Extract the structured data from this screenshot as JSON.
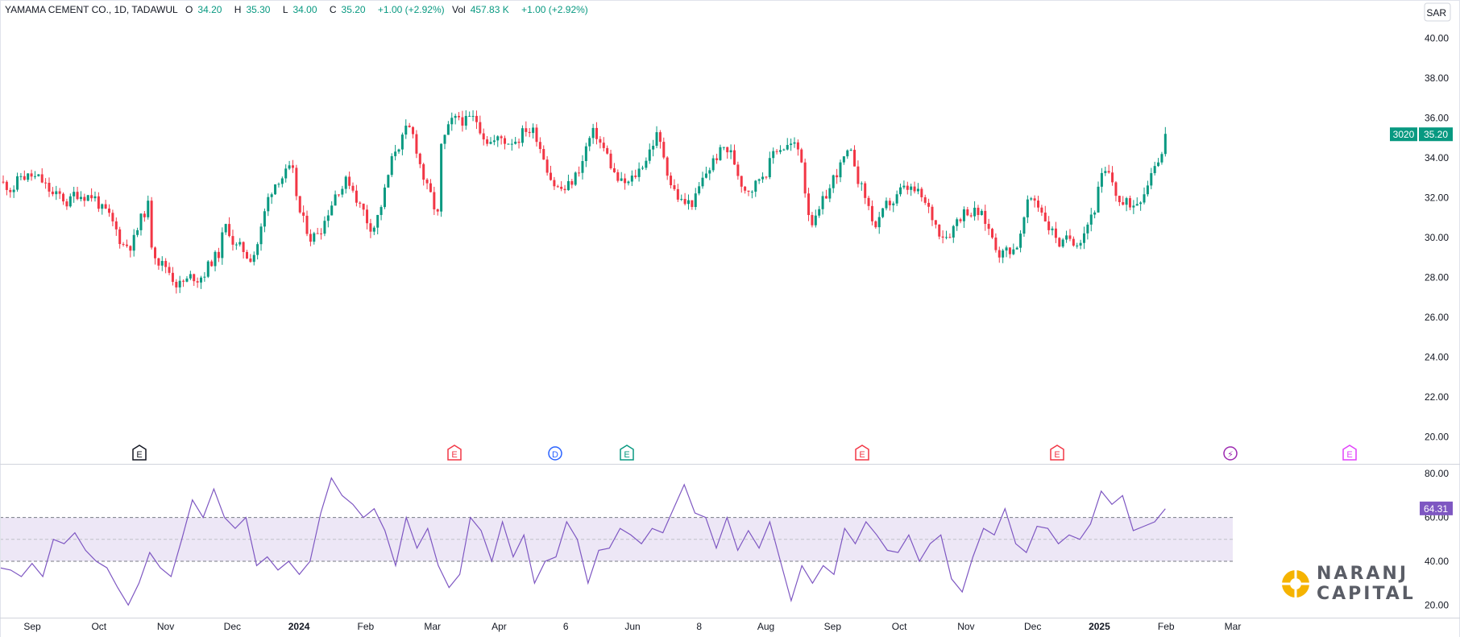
{
  "header": {
    "symbol": "YAMAMA CEMENT CO., 1D, TADAWUL",
    "o_label": "O",
    "o_value": "34.20",
    "h_label": "H",
    "h_value": "35.30",
    "l_label": "L",
    "l_value": "34.00",
    "c_label": "C",
    "c_value": "35.20",
    "change": "+1.00 (+2.92%)",
    "vol_label": "Vol",
    "vol_value": "457.83 K",
    "vol_change": "+1.00 (+2.92%)"
  },
  "price_axis": {
    "currency": "SAR",
    "countdown": "3020",
    "last_price": "35.20"
  },
  "rsi_axis": {
    "last_value": "64.31"
  },
  "logo": {
    "line1": "NARANJ",
    "line2": "CAPITAL"
  },
  "colors": {
    "up": "#089981",
    "down": "#f23645",
    "rsi": "#7e57c2",
    "rsi_band": "#ede7f6",
    "logo_orange": "#f5b301"
  },
  "chart_data": [
    {
      "type": "candlestick",
      "title": "YAMAMA CEMENT CO., 1D, TADAWUL",
      "ylim": [
        19.5,
        40.5
      ],
      "y_ticks": [
        "20.00",
        "22.00",
        "24.00",
        "26.00",
        "28.00",
        "30.00",
        "32.00",
        "34.00",
        "36.00",
        "38.00",
        "40.00"
      ],
      "x_ticks": [
        "Sep",
        "Oct",
        "Nov",
        "Dec",
        "2024",
        "Feb",
        "Mar",
        "Apr",
        "6",
        "Jun",
        "8",
        "Aug",
        "Sep",
        "Oct",
        "Nov",
        "Dec",
        "2025",
        "Feb",
        "Mar"
      ],
      "series": [
        {
          "values": [
            {
              "period": "Sep 2023",
              "low": 31.5,
              "high": 33.3,
              "close": 32.4
            },
            {
              "period": "Oct 2023",
              "low": 29.2,
              "high": 32.8,
              "close": 29.6
            },
            {
              "period": "Nov 2023",
              "low": 27.5,
              "high": 29.5,
              "close": 28.0
            },
            {
              "period": "Dec 2023",
              "low": 28.5,
              "high": 34.2,
              "close": 33.2
            },
            {
              "period": "Jan 2024",
              "low": 29.3,
              "high": 33.6,
              "close": 29.8
            },
            {
              "period": "Feb 2024",
              "low": 30.0,
              "high": 35.9,
              "close": 34.8
            },
            {
              "period": "Mar 2024",
              "low": 34.7,
              "high": 36.1,
              "close": 35.7
            },
            {
              "period": "Apr 2024",
              "low": 32.0,
              "high": 36.0,
              "close": 33.8
            },
            {
              "period": "May 2024",
              "low": 32.0,
              "high": 35.9,
              "close": 34.8
            },
            {
              "period": "Jun 2024",
              "low": 31.2,
              "high": 34.8,
              "close": 32.5
            },
            {
              "period": "Jul 2024",
              "low": 32.3,
              "high": 35.2,
              "close": 34.6
            },
            {
              "period": "Aug 2024",
              "low": 29.7,
              "high": 34.4,
              "close": 30.3
            },
            {
              "period": "Sep 2024",
              "low": 30.0,
              "high": 32.6,
              "close": 31.8
            },
            {
              "period": "Oct 2024",
              "low": 29.0,
              "high": 32.0,
              "close": 29.6
            },
            {
              "period": "Nov 2024",
              "low": 29.3,
              "high": 32.5,
              "close": 31.6
            },
            {
              "period": "Dec 2024",
              "low": 31.0,
              "high": 35.3,
              "close": 35.2
            }
          ]
        }
      ],
      "events": [
        {
          "date": "Oct 2023",
          "label": "E",
          "color": "#131722"
        },
        {
          "date": "Feb 2024",
          "label": "E",
          "color": "#f23645"
        },
        {
          "date": "Mar 2024",
          "label": "D",
          "color": "#2962ff"
        },
        {
          "date": "Apr 2024",
          "label": "E",
          "color": "#089981"
        },
        {
          "date": "Jul 2024",
          "label": "E",
          "color": "#f23645"
        },
        {
          "date": "Oct 2024",
          "label": "E",
          "color": "#f23645"
        },
        {
          "date": "Dec 2024",
          "label": "⚡",
          "color": "#9c27b0"
        },
        {
          "date": "Feb 2025",
          "label": "E",
          "color": "#e040fb"
        }
      ]
    },
    {
      "type": "line",
      "ylim": [
        15,
        83
      ],
      "y_ticks": [
        "20.00",
        "40.00",
        "60.00",
        "80.00"
      ],
      "bands": [
        40,
        50,
        60
      ],
      "series": [
        {
          "values": [
            37,
            36,
            33,
            39,
            33,
            50,
            48,
            53,
            45,
            40,
            37,
            28,
            20,
            30,
            44,
            37,
            33,
            50,
            68,
            60,
            73,
            60,
            55,
            60,
            38,
            42,
            36,
            40,
            34,
            40,
            62,
            78,
            70,
            66,
            60,
            64,
            54,
            38,
            60,
            46,
            55,
            38,
            28,
            34,
            60,
            54,
            40,
            58,
            42,
            52,
            30,
            40,
            42,
            58,
            50,
            30,
            45,
            46,
            55,
            52,
            48,
            55,
            53,
            64,
            75,
            62,
            60,
            46,
            60,
            45,
            54,
            46,
            58,
            40,
            22,
            38,
            30,
            38,
            34,
            55,
            48,
            58,
            52,
            45,
            44,
            52,
            40,
            48,
            52,
            32,
            26,
            42,
            55,
            52,
            64,
            48,
            44,
            56,
            55,
            48,
            52,
            50,
            57,
            72,
            66,
            70,
            54,
            56,
            58,
            64
          ]
        }
      ]
    }
  ]
}
